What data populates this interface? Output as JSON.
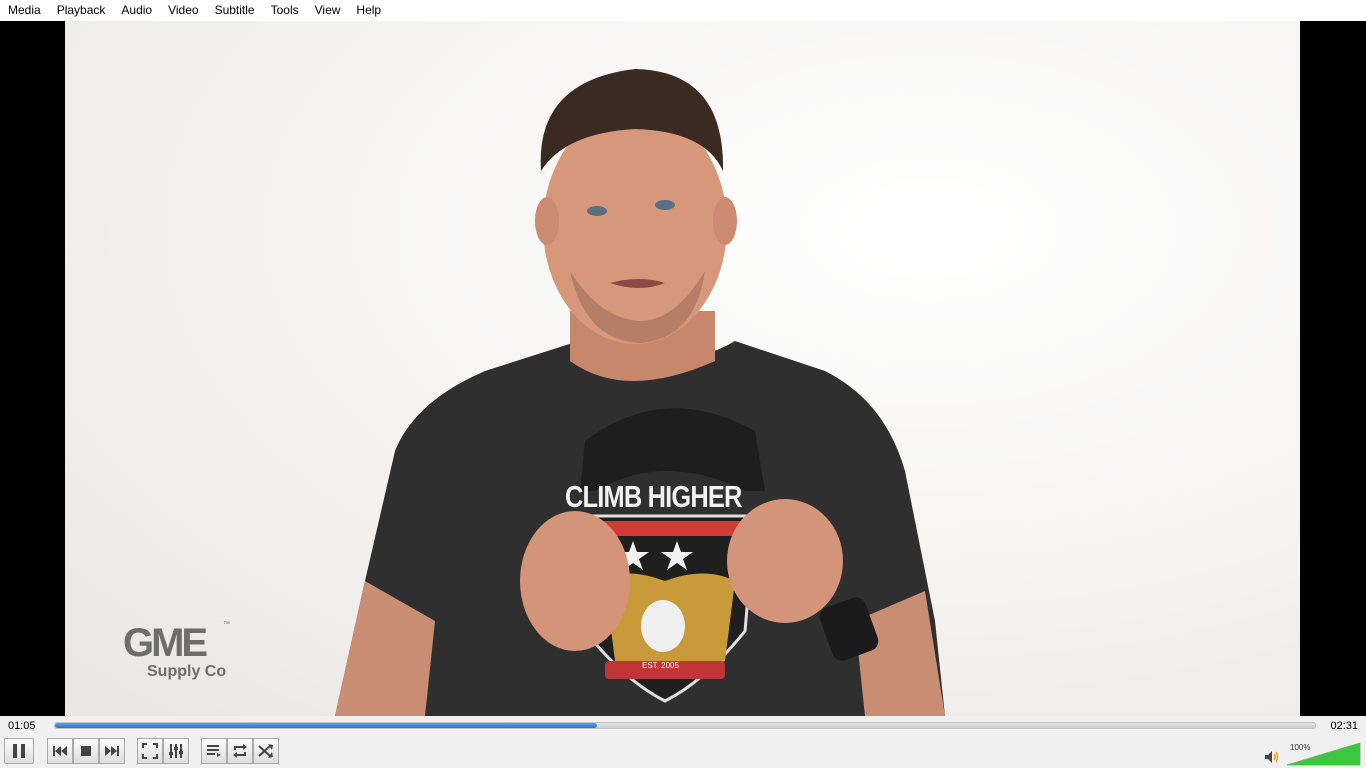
{
  "menu": [
    "Media",
    "Playback",
    "Audio",
    "Video",
    "Subtitle",
    "Tools",
    "View",
    "Help"
  ],
  "video": {
    "watermark_main": "GME",
    "watermark_tm": "™",
    "watermark_sub": "Supply Co",
    "shirt_text": "CLIMB HIGHER",
    "shirt_year": "EST. 2005"
  },
  "playback": {
    "elapsed": "01:05",
    "total": "02:31",
    "progress_fraction": 0.43
  },
  "controls": {
    "buttons": [
      "pause-icon",
      "previous-icon",
      "stop-icon",
      "next-icon",
      "fullscreen-icon",
      "extended-settings-icon",
      "playlist-icon",
      "loop-icon",
      "shuffle-icon"
    ]
  },
  "volume": {
    "label": "100%",
    "level_fraction": 1.0,
    "color": "#3cc83c"
  },
  "colors": {
    "accent": "#2b74c9",
    "menubar": "#ffffff",
    "controls_bg": "#f0f0f0"
  }
}
